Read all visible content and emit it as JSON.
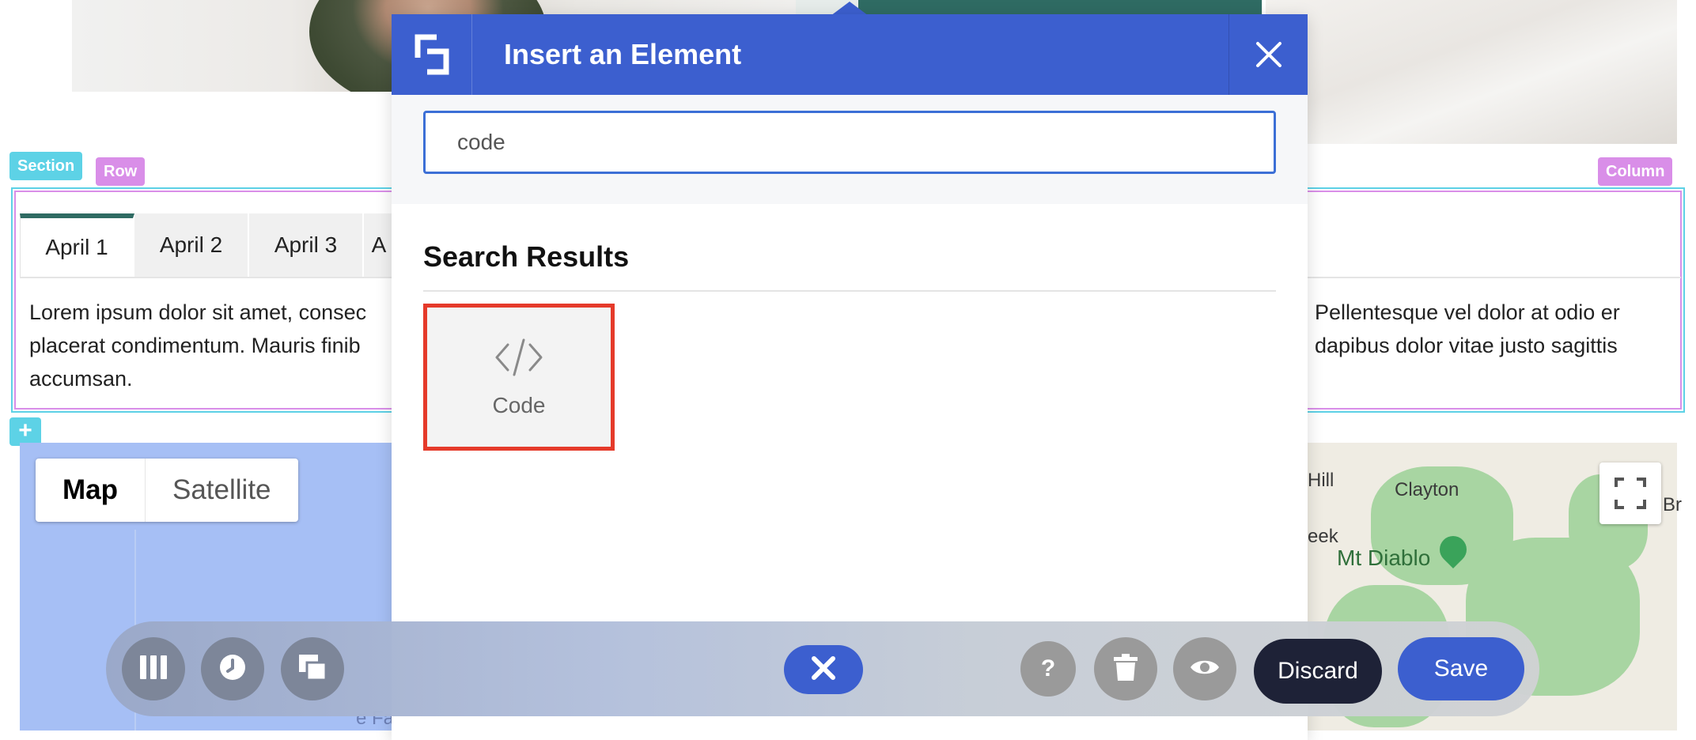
{
  "builder": {
    "section_tag": "Section",
    "row_tag": "Row",
    "column_tag": "Column",
    "add_label": "+"
  },
  "tabs": {
    "items": [
      {
        "label": "April 1"
      },
      {
        "label": "April 2"
      },
      {
        "label": "April 3"
      },
      {
        "label": "A"
      }
    ],
    "content_left": "Lorem ipsum dolor sit amet, consec placerat condimentum. Mauris finib accumsan.",
    "content_right": "Pellentesque vel dolor at odio er dapibus dolor vitae justo sagittis"
  },
  "map": {
    "map_label": "Map",
    "satellite_label": "Satellite",
    "places": [
      "Hill",
      "Clayton",
      "eek",
      "Mt Diablo",
      "Br",
      "e Fa"
    ]
  },
  "modal": {
    "title": "Insert an Element",
    "search_value": "code",
    "results_title": "Search Results",
    "results": [
      {
        "label": "Code",
        "icon": "code-icon"
      }
    ]
  },
  "toolbar": {
    "discard_label": "Discard",
    "save_label": "Save"
  }
}
